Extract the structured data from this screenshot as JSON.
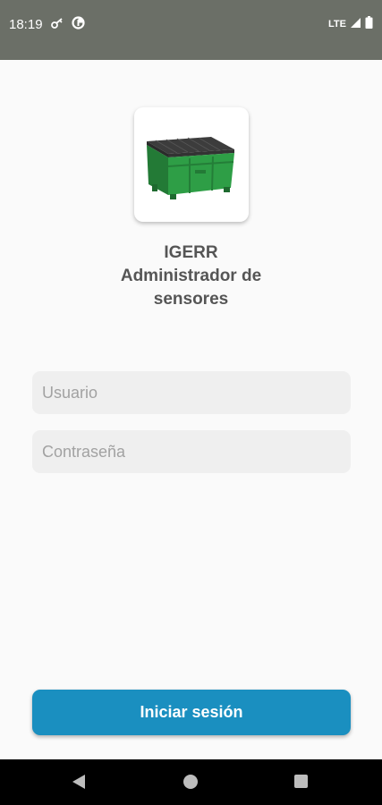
{
  "status_bar": {
    "time": "18:19",
    "network": "LTE",
    "icons": [
      "key-icon",
      "data-saver-icon",
      "signal-icon",
      "battery-icon"
    ]
  },
  "app": {
    "title_line1": "IGERR",
    "title_line2": "Administrador de",
    "title_line3": "sensores",
    "logo": "dumpster-icon"
  },
  "form": {
    "username_placeholder": "Usuario",
    "password_placeholder": "Contraseña",
    "username_value": "",
    "password_value": ""
  },
  "login_button": {
    "label": "Iniciar sesión"
  },
  "nav_bar": {
    "icons": [
      "back-icon",
      "home-icon",
      "recents-icon"
    ]
  },
  "colors": {
    "status_bar": "#6b6f67",
    "background": "#fafafa",
    "field_bg": "#efefef",
    "button": "#1a8fc0",
    "title_text": "#555555",
    "dumpster_green": "#2e9e46"
  }
}
